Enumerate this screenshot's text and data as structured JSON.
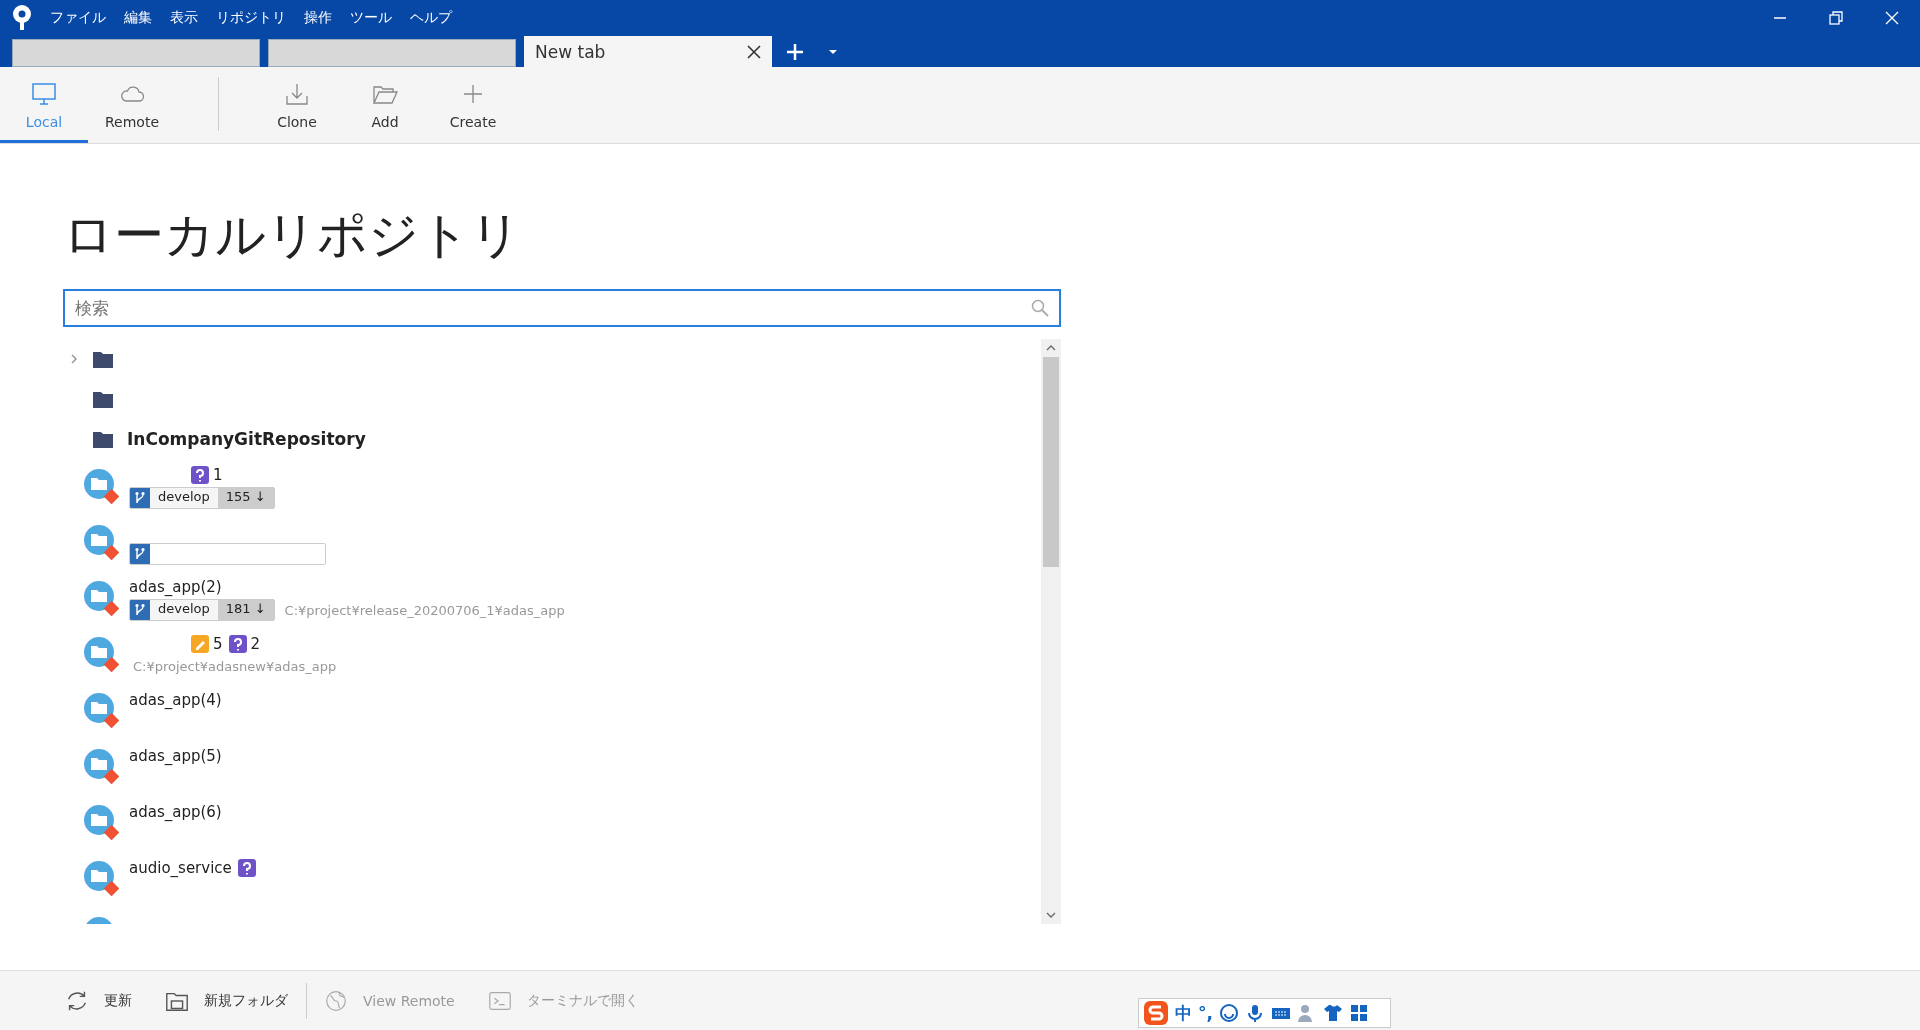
{
  "menu": [
    "ファイル",
    "編集",
    "表示",
    "リポジトリ",
    "操作",
    "ツール",
    "ヘルプ"
  ],
  "tabs": [
    {
      "selected": false
    },
    {
      "selected": false
    },
    {
      "label": "New tab",
      "selected": true
    }
  ],
  "views": [
    {
      "label": "Local",
      "kind": "monitor",
      "selected": true
    },
    {
      "label": "Remote",
      "kind": "cloud",
      "selected": false
    }
  ],
  "actions": [
    {
      "label": "Clone",
      "kind": "download"
    },
    {
      "label": "Add",
      "kind": "folder-open"
    },
    {
      "label": "Create",
      "kind": "plus"
    }
  ],
  "heading": "ローカルリポジトリ",
  "search": {
    "placeholder": "検索"
  },
  "tree": [
    {
      "kind": "collapsed-group"
    },
    {
      "kind": "group"
    },
    {
      "kind": "group",
      "label": "InCompanyGitRepository"
    },
    {
      "kind": "repo",
      "badges": [
        {
          "kind": "untracked",
          "count": "1"
        }
      ],
      "branch": "develop",
      "behind": "155 ↓"
    },
    {
      "kind": "repo",
      "branch_outline": true
    },
    {
      "kind": "repo",
      "name": "adas_app(2)",
      "branch": "develop",
      "behind": "181 ↓",
      "path": "C:¥project¥release_20200706_1¥adas_app"
    },
    {
      "kind": "repo",
      "badges": [
        {
          "kind": "modified",
          "count": "5"
        },
        {
          "kind": "untracked",
          "count": "2"
        }
      ],
      "path": "C:¥project¥adasnew¥adas_app"
    },
    {
      "kind": "repo",
      "name": "adas_app(4)"
    },
    {
      "kind": "repo",
      "name": "adas_app(5)"
    },
    {
      "kind": "repo",
      "name": "adas_app(6)"
    },
    {
      "kind": "repo",
      "name": "audio_service",
      "badges": [
        {
          "kind": "untracked"
        }
      ]
    },
    {
      "kind": "repo"
    }
  ],
  "bottom": [
    {
      "label": "更新",
      "kind": "refresh",
      "disabled": false
    },
    {
      "label": "新規フォルダ",
      "kind": "new-folder",
      "disabled": false
    },
    {
      "label": "View Remote",
      "kind": "globe",
      "disabled": true
    },
    {
      "label": "ターミナルで開く",
      "kind": "terminal",
      "disabled": true
    }
  ],
  "ime": [
    "中",
    "°,"
  ]
}
